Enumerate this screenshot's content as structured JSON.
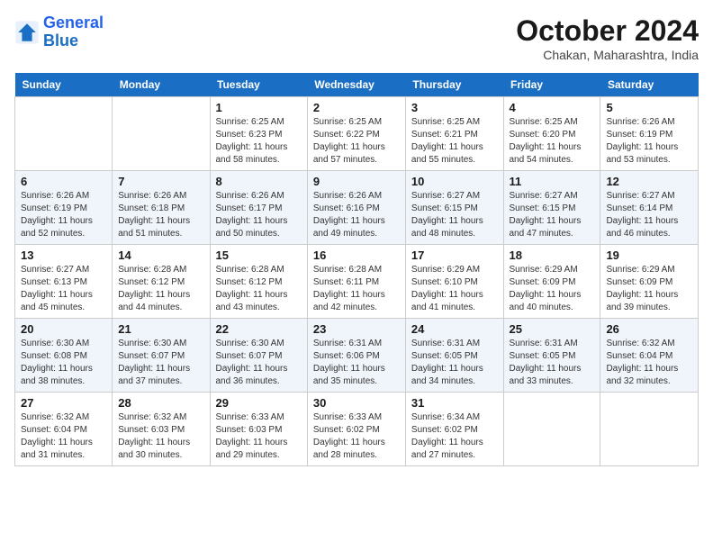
{
  "logo": {
    "line1": "General",
    "line2": "Blue"
  },
  "title": "October 2024",
  "location": "Chakan, Maharashtra, India",
  "days_of_week": [
    "Sunday",
    "Monday",
    "Tuesday",
    "Wednesday",
    "Thursday",
    "Friday",
    "Saturday"
  ],
  "weeks": [
    [
      {
        "day": "",
        "detail": ""
      },
      {
        "day": "",
        "detail": ""
      },
      {
        "day": "1",
        "detail": "Sunrise: 6:25 AM\nSunset: 6:23 PM\nDaylight: 11 hours and 58 minutes."
      },
      {
        "day": "2",
        "detail": "Sunrise: 6:25 AM\nSunset: 6:22 PM\nDaylight: 11 hours and 57 minutes."
      },
      {
        "day": "3",
        "detail": "Sunrise: 6:25 AM\nSunset: 6:21 PM\nDaylight: 11 hours and 55 minutes."
      },
      {
        "day": "4",
        "detail": "Sunrise: 6:25 AM\nSunset: 6:20 PM\nDaylight: 11 hours and 54 minutes."
      },
      {
        "day": "5",
        "detail": "Sunrise: 6:26 AM\nSunset: 6:19 PM\nDaylight: 11 hours and 53 minutes."
      }
    ],
    [
      {
        "day": "6",
        "detail": "Sunrise: 6:26 AM\nSunset: 6:19 PM\nDaylight: 11 hours and 52 minutes."
      },
      {
        "day": "7",
        "detail": "Sunrise: 6:26 AM\nSunset: 6:18 PM\nDaylight: 11 hours and 51 minutes."
      },
      {
        "day": "8",
        "detail": "Sunrise: 6:26 AM\nSunset: 6:17 PM\nDaylight: 11 hours and 50 minutes."
      },
      {
        "day": "9",
        "detail": "Sunrise: 6:26 AM\nSunset: 6:16 PM\nDaylight: 11 hours and 49 minutes."
      },
      {
        "day": "10",
        "detail": "Sunrise: 6:27 AM\nSunset: 6:15 PM\nDaylight: 11 hours and 48 minutes."
      },
      {
        "day": "11",
        "detail": "Sunrise: 6:27 AM\nSunset: 6:15 PM\nDaylight: 11 hours and 47 minutes."
      },
      {
        "day": "12",
        "detail": "Sunrise: 6:27 AM\nSunset: 6:14 PM\nDaylight: 11 hours and 46 minutes."
      }
    ],
    [
      {
        "day": "13",
        "detail": "Sunrise: 6:27 AM\nSunset: 6:13 PM\nDaylight: 11 hours and 45 minutes."
      },
      {
        "day": "14",
        "detail": "Sunrise: 6:28 AM\nSunset: 6:12 PM\nDaylight: 11 hours and 44 minutes."
      },
      {
        "day": "15",
        "detail": "Sunrise: 6:28 AM\nSunset: 6:12 PM\nDaylight: 11 hours and 43 minutes."
      },
      {
        "day": "16",
        "detail": "Sunrise: 6:28 AM\nSunset: 6:11 PM\nDaylight: 11 hours and 42 minutes."
      },
      {
        "day": "17",
        "detail": "Sunrise: 6:29 AM\nSunset: 6:10 PM\nDaylight: 11 hours and 41 minutes."
      },
      {
        "day": "18",
        "detail": "Sunrise: 6:29 AM\nSunset: 6:09 PM\nDaylight: 11 hours and 40 minutes."
      },
      {
        "day": "19",
        "detail": "Sunrise: 6:29 AM\nSunset: 6:09 PM\nDaylight: 11 hours and 39 minutes."
      }
    ],
    [
      {
        "day": "20",
        "detail": "Sunrise: 6:30 AM\nSunset: 6:08 PM\nDaylight: 11 hours and 38 minutes."
      },
      {
        "day": "21",
        "detail": "Sunrise: 6:30 AM\nSunset: 6:07 PM\nDaylight: 11 hours and 37 minutes."
      },
      {
        "day": "22",
        "detail": "Sunrise: 6:30 AM\nSunset: 6:07 PM\nDaylight: 11 hours and 36 minutes."
      },
      {
        "day": "23",
        "detail": "Sunrise: 6:31 AM\nSunset: 6:06 PM\nDaylight: 11 hours and 35 minutes."
      },
      {
        "day": "24",
        "detail": "Sunrise: 6:31 AM\nSunset: 6:05 PM\nDaylight: 11 hours and 34 minutes."
      },
      {
        "day": "25",
        "detail": "Sunrise: 6:31 AM\nSunset: 6:05 PM\nDaylight: 11 hours and 33 minutes."
      },
      {
        "day": "26",
        "detail": "Sunrise: 6:32 AM\nSunset: 6:04 PM\nDaylight: 11 hours and 32 minutes."
      }
    ],
    [
      {
        "day": "27",
        "detail": "Sunrise: 6:32 AM\nSunset: 6:04 PM\nDaylight: 11 hours and 31 minutes."
      },
      {
        "day": "28",
        "detail": "Sunrise: 6:32 AM\nSunset: 6:03 PM\nDaylight: 11 hours and 30 minutes."
      },
      {
        "day": "29",
        "detail": "Sunrise: 6:33 AM\nSunset: 6:03 PM\nDaylight: 11 hours and 29 minutes."
      },
      {
        "day": "30",
        "detail": "Sunrise: 6:33 AM\nSunset: 6:02 PM\nDaylight: 11 hours and 28 minutes."
      },
      {
        "day": "31",
        "detail": "Sunrise: 6:34 AM\nSunset: 6:02 PM\nDaylight: 11 hours and 27 minutes."
      },
      {
        "day": "",
        "detail": ""
      },
      {
        "day": "",
        "detail": ""
      }
    ]
  ]
}
